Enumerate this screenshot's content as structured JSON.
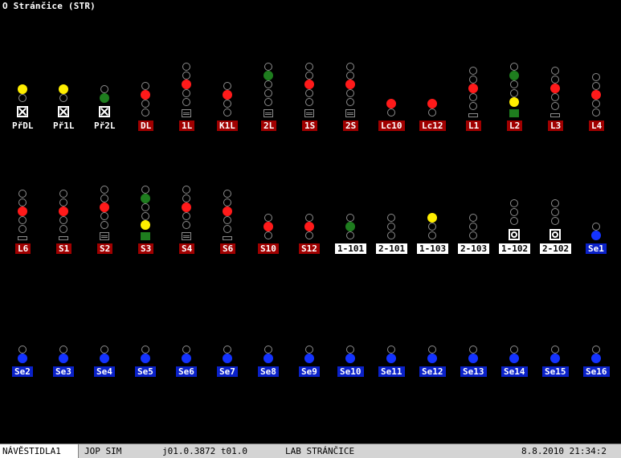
{
  "window": {
    "title": "O Stránčice (STR)"
  },
  "colors": {
    "red": "#ff1a1a",
    "green": "#1e7d1e",
    "yellow": "#ffee00",
    "blue": "#1433ff",
    "label_red": "#a00000",
    "label_blue": "#0a21c9",
    "label_white": "#ffffff"
  },
  "signals": [
    {
      "label": "PřDL",
      "style": "plain",
      "box": "x",
      "lamps": [
        "yellow",
        "off"
      ]
    },
    {
      "label": "Př1L",
      "style": "plain",
      "box": "x",
      "lamps": [
        "yellow",
        "off"
      ]
    },
    {
      "label": "Př2L",
      "style": "plain",
      "box": "x",
      "lamps": [
        "off",
        "green"
      ]
    },
    {
      "label": "DL",
      "style": "red",
      "lamps": [
        "off",
        "red",
        "off",
        "off"
      ]
    },
    {
      "label": "1L",
      "style": "red",
      "lamps": [
        "off",
        "off",
        "red",
        "off",
        "off"
      ],
      "shunt": "lines"
    },
    {
      "label": "K1L",
      "style": "red",
      "lamps": [
        "off",
        "red",
        "off",
        "off"
      ]
    },
    {
      "label": "2L",
      "style": "red",
      "lamps": [
        "off",
        "green",
        "off",
        "off",
        "off"
      ],
      "shunt": "lines"
    },
    {
      "label": "1S",
      "style": "red",
      "lamps": [
        "off",
        "off",
        "red",
        "off",
        "off"
      ],
      "shunt": "lines"
    },
    {
      "label": "2S",
      "style": "red",
      "lamps": [
        "off",
        "off",
        "red",
        "off",
        "off"
      ],
      "shunt": "lines"
    },
    {
      "label": "Lc10",
      "style": "red",
      "lamps": [
        "red",
        "off"
      ]
    },
    {
      "label": "Lc12",
      "style": "red",
      "lamps": [
        "red",
        "off"
      ]
    },
    {
      "label": "L1",
      "style": "red",
      "lamps": [
        "off",
        "off",
        "red",
        "off",
        "off"
      ],
      "shunt": "bar"
    },
    {
      "label": "L2",
      "style": "red",
      "lamps": [
        "off",
        "green",
        "off",
        "off",
        "yellow"
      ],
      "shunt": "on"
    },
    {
      "label": "L3",
      "style": "red",
      "lamps": [
        "off",
        "off",
        "red",
        "off",
        "off"
      ],
      "shunt": "bar"
    },
    {
      "label": "L4",
      "style": "red",
      "lamps": [
        "off",
        "off",
        "red",
        "off",
        "off"
      ]
    },
    {
      "label": "L6",
      "style": "red",
      "lamps": [
        "off",
        "off",
        "red",
        "off",
        "off"
      ],
      "shunt": "bar"
    },
    {
      "label": "S1",
      "style": "red",
      "lamps": [
        "off",
        "off",
        "red",
        "off",
        "off"
      ],
      "shunt": "bar"
    },
    {
      "label": "S2",
      "style": "red",
      "lamps": [
        "off",
        "off",
        "red",
        "off",
        "off"
      ],
      "shunt": "lines"
    },
    {
      "label": "S3",
      "style": "red",
      "lamps": [
        "off",
        "green",
        "off",
        "off",
        "yellow"
      ],
      "shunt": "on"
    },
    {
      "label": "S4",
      "style": "red",
      "lamps": [
        "off",
        "off",
        "red",
        "off",
        "off"
      ],
      "shunt": "lines"
    },
    {
      "label": "S6",
      "style": "red",
      "lamps": [
        "off",
        "off",
        "red",
        "off",
        "off"
      ],
      "shunt": "bar"
    },
    {
      "label": "S10",
      "style": "red",
      "lamps": [
        "off",
        "red",
        "off"
      ]
    },
    {
      "label": "S12",
      "style": "red",
      "lamps": [
        "off",
        "red",
        "off"
      ]
    },
    {
      "label": "1-101",
      "style": "white",
      "lamps": [
        "off",
        "green",
        "off"
      ]
    },
    {
      "label": "2-101",
      "style": "white",
      "lamps": [
        "off",
        "off",
        "off"
      ]
    },
    {
      "label": "1-103",
      "style": "white",
      "lamps": [
        "yellow",
        "off",
        "off"
      ]
    },
    {
      "label": "2-103",
      "style": "white",
      "lamps": [
        "off",
        "off",
        "off"
      ]
    },
    {
      "label": "1-102",
      "style": "white",
      "box": "t",
      "lamps": [
        "off",
        "off",
        "off"
      ]
    },
    {
      "label": "2-102",
      "style": "white",
      "box": "t",
      "lamps": [
        "off",
        "off",
        "off"
      ]
    },
    {
      "label": "Se1",
      "style": "blue",
      "lamps": [
        "off",
        "blue"
      ]
    },
    {
      "label": "Se2",
      "style": "blue",
      "lamps": [
        "off",
        "blue"
      ]
    },
    {
      "label": "Se3",
      "style": "blue",
      "lamps": [
        "off",
        "blue"
      ]
    },
    {
      "label": "Se4",
      "style": "blue",
      "lamps": [
        "off",
        "blue"
      ]
    },
    {
      "label": "Se5",
      "style": "blue",
      "lamps": [
        "off",
        "blue"
      ]
    },
    {
      "label": "Se6",
      "style": "blue",
      "lamps": [
        "off",
        "blue"
      ]
    },
    {
      "label": "Se7",
      "style": "blue",
      "lamps": [
        "off",
        "blue"
      ]
    },
    {
      "label": "Se8",
      "style": "blue",
      "lamps": [
        "off",
        "blue"
      ]
    },
    {
      "label": "Se9",
      "style": "blue",
      "lamps": [
        "off",
        "blue"
      ]
    },
    {
      "label": "Se10",
      "style": "blue",
      "lamps": [
        "off",
        "blue"
      ]
    },
    {
      "label": "Se11",
      "style": "blue",
      "lamps": [
        "off",
        "blue"
      ]
    },
    {
      "label": "Se12",
      "style": "blue",
      "lamps": [
        "off",
        "blue"
      ]
    },
    {
      "label": "Se13",
      "style": "blue",
      "lamps": [
        "off",
        "blue"
      ]
    },
    {
      "label": "Se14",
      "style": "blue",
      "lamps": [
        "off",
        "blue"
      ]
    },
    {
      "label": "Se15",
      "style": "blue",
      "lamps": [
        "off",
        "blue"
      ]
    },
    {
      "label": "Se16",
      "style": "blue",
      "lamps": [
        "off",
        "blue"
      ]
    }
  ],
  "statusbar": {
    "tab": "NÁVĚSTIDLA1",
    "mode": "JOP SIM",
    "version": "j01.0.3872 t01.0",
    "station": "LAB STRÁNČICE",
    "datetime": "8.8.2010 21:34:2"
  }
}
